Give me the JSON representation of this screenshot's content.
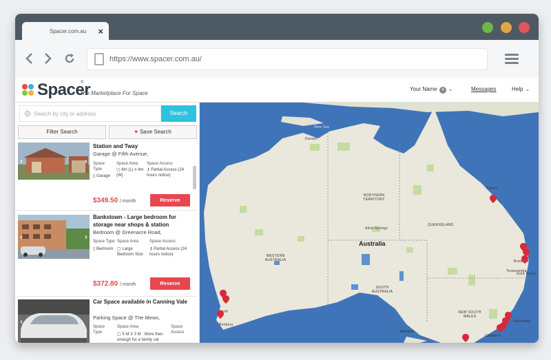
{
  "browser": {
    "tab_title": "Spacer.com.au",
    "tab_close": "×",
    "url": "https://www.spacer.com.au/",
    "window_dots": [
      "#6cb847",
      "#e0a649",
      "#e2555a"
    ],
    "icons": {
      "back": "chevron-left-icon",
      "forward": "chevron-right-icon",
      "reload": "reload-icon",
      "menu": "hamburger-menu-icon"
    }
  },
  "header": {
    "logo_text": "Spacer",
    "logo_mark": "®",
    "tagline": "The Marketplace For Space",
    "user_name": "Your Name",
    "user_badge": "4",
    "messages": "Messages",
    "help": "Help",
    "logo_colors": [
      "#e8474f",
      "#3db0e3",
      "#8ac53f",
      "#f4b433"
    ]
  },
  "search": {
    "placeholder": "Search by city or address",
    "button": "Search",
    "filter_button": "Filter Search",
    "save_button": "Save Search"
  },
  "listings": [
    {
      "title": "Station and Tway",
      "subtitle": "Garage @ Fifth Avenue,",
      "type_label": "Space Type",
      "type_value": "Garage",
      "area_label": "Space Area",
      "area_value": "6m (L) x 4m (W)",
      "access_label": "Space Access",
      "access_value": "Partial Access (24 hours notice)",
      "price": "$349.50",
      "per": "/ month",
      "reserve": "Reserve"
    },
    {
      "title": "Bankstown - Large bedroom for storage near shops & station",
      "subtitle": "Bedroom @ Greenacre Road,",
      "type_label": "Space Type",
      "type_value": "Bedroom",
      "area_label": "Space Area",
      "area_value": "Large Bedroom Size",
      "access_label": "Space Access",
      "access_value": "Partial Access (24 hours notice)",
      "price": "$372.80",
      "per": "/ month",
      "reserve": "Reserve"
    },
    {
      "title": "Car Space available in Canning Vale",
      "subtitle": "Parking Space @ The Mews,",
      "type_label": "Space Type",
      "area_label": "Space Area",
      "area_value": "5 M X 3 M . More than enough for a family car",
      "access_label": "Space Access"
    }
  ],
  "map": {
    "country": "Australia",
    "labels": {
      "nt": "NORTHERN TERRITORY",
      "qld": "QUEENSLAND",
      "wa": "WESTERN AUSTRALIA",
      "sa": "SOUTH AUSTRALIA",
      "nsw": "NEW SOUTH WALES",
      "alice": "Alice Springs",
      "darwin": "Darwin",
      "cairns": "Cairns",
      "brisbane": "Brisbane",
      "gold_coast": "Gold Coast",
      "toowoomba": "Toowoomba",
      "perth": "Perth",
      "bunbury": "Bunbury",
      "adelaide": "Adelaide",
      "newcastle": "Newcastle",
      "canberra": "Canberra",
      "timor_sea": "Timor Sea",
      "arafura_sea": "Arafura Sea"
    },
    "colors": {
      "ocean": "#3f74b8",
      "land": "#eae7dc",
      "park": "#c5dca0",
      "marker": "#d6293a"
    }
  }
}
